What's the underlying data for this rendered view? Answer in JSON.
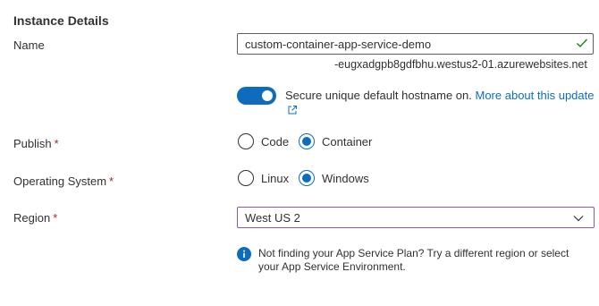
{
  "section": {
    "title": "Instance Details"
  },
  "name_field": {
    "label": "Name",
    "value": "custom-container-app-service-demo",
    "suffix": "-eugxadgpb8gdfbhu.westus2-01.azurewebsites.net",
    "valid_icon": "checkmark-icon"
  },
  "hostname_toggle": {
    "state": "on",
    "text": "Secure unique default hostname on.",
    "link_text": "More about this update",
    "link_icon": "external-link-icon"
  },
  "publish": {
    "label": "Publish",
    "required_marker": "*",
    "options": [
      {
        "label": "Code",
        "selected": false
      },
      {
        "label": "Container",
        "selected": true
      }
    ]
  },
  "operating_system": {
    "label": "Operating System",
    "required_marker": "*",
    "options": [
      {
        "label": "Linux",
        "selected": false
      },
      {
        "label": "Windows",
        "selected": true
      }
    ]
  },
  "region": {
    "label": "Region",
    "required_marker": "*",
    "selected": "West US 2",
    "icon": "chevron-down-icon"
  },
  "region_info": {
    "icon": "info-icon",
    "line1": "Not finding your App Service Plan? Try a different region or select",
    "line2": "your App Service Environment."
  },
  "colors": {
    "accent": "#0f6cbd",
    "required": "#a4262c",
    "valid_check": "#107c10",
    "focus_border": "#8a5a9e"
  }
}
